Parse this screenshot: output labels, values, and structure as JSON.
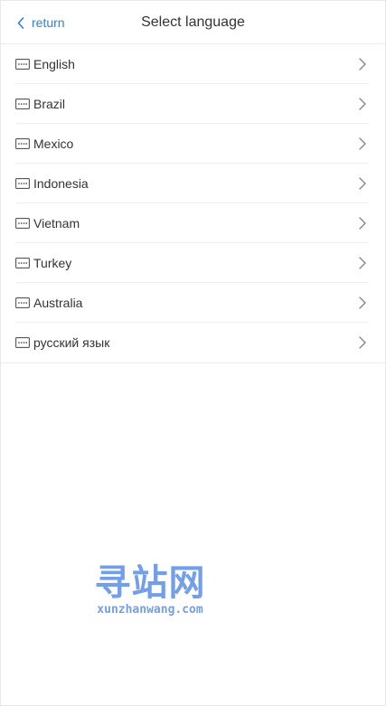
{
  "header": {
    "back_label": "return",
    "title": "Select language"
  },
  "colors": {
    "accent": "#2e7fd9",
    "text": "#333333",
    "divider": "#efefef",
    "chevron": "#888888",
    "watermark": "#5b8ee6"
  },
  "languages": [
    {
      "label": "English",
      "icon": "keyboard-icon"
    },
    {
      "label": "Brazil",
      "icon": "keyboard-icon"
    },
    {
      "label": "Mexico",
      "icon": "keyboard-icon"
    },
    {
      "label": "Indonesia",
      "icon": "keyboard-icon"
    },
    {
      "label": "Vietnam",
      "icon": "keyboard-icon"
    },
    {
      "label": "Turkey",
      "icon": "keyboard-icon"
    },
    {
      "label": "Australia",
      "icon": "keyboard-icon"
    },
    {
      "label": "русский язык",
      "icon": "keyboard-icon"
    }
  ],
  "watermark": {
    "logo": "寻站网",
    "domain": "xunzhanwang.com"
  }
}
